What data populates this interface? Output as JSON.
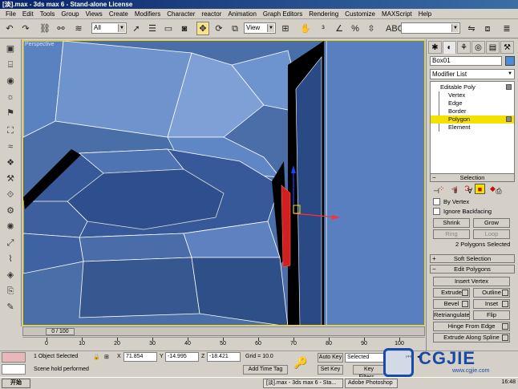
{
  "window": {
    "title": "[淡].max - 3ds max 6 - Stand-alone License"
  },
  "menu": [
    "File",
    "Edit",
    "Tools",
    "Group",
    "Views",
    "Create",
    "Modifiers",
    "Character",
    "reactor",
    "Animation",
    "Graph Editors",
    "Rendering",
    "Customize",
    "MAXScript",
    "Help"
  ],
  "toolbar": {
    "selection_filter": "All",
    "ref_coord": "View",
    "named_sel": ""
  },
  "viewport": {
    "label": "Perspective"
  },
  "timeline": {
    "frame_display": "0 / 100",
    "ticks": [
      "0",
      "10",
      "20",
      "30",
      "40",
      "50",
      "60",
      "70",
      "80",
      "90",
      "100"
    ]
  },
  "status": {
    "selection": "1 Object Selected",
    "prompt": "Scene hold performed",
    "x_label": "X",
    "x": "71.854",
    "y_label": "Y",
    "y": "-14.995",
    "z_label": "Z",
    "z": "-18.421",
    "grid": "Grid = 10.0",
    "add_time_tag": "Add Time Tag",
    "auto_key": "Auto Key",
    "set_key": "Set Key",
    "key_mode": "Selected",
    "key_filters": "Key Filters..."
  },
  "command_panel": {
    "object_name": "Box01",
    "modifier_list": "Modifier List",
    "stack": {
      "base": "Editable Poly",
      "subs": [
        "Vertex",
        "Edge",
        "Border",
        "Polygon",
        "Element"
      ],
      "selected": "Polygon"
    },
    "selection_rollout": {
      "title": "Selection",
      "by_vertex": "By Vertex",
      "ignore_backfacing": "Ignore Backfacing",
      "shrink": "Shrink",
      "grow": "Grow",
      "ring": "Ring",
      "loop": "Loop",
      "status": "2 Polygons Selected"
    },
    "soft_selection": {
      "title": "Soft Selection"
    },
    "edit_polygons": {
      "title": "Edit Polygons",
      "insert_vertex": "Insert Vertex",
      "extrude": "Extrude",
      "outline": "Outline",
      "bevel": "Bevel",
      "inset": "Inset",
      "retriangulate": "Retriangulate",
      "flip": "Flip",
      "hinge_from_edge": "Hinge From Edge",
      "extrude_along_spline": "Extrude Along Spline"
    }
  },
  "taskbar": {
    "start": "开始",
    "tasks": [
      "[淡].max - 3ds max 6 - Sta...",
      "Adobe Photoshop"
    ],
    "clock": "16:48"
  },
  "watermark": {
    "brand": "CGJIE",
    "url": "www.cgjie.com"
  },
  "colors": {
    "selection_yellow": "#f5e100",
    "viewport_blue": "#4a6ea8",
    "poly_red": "#d02020"
  }
}
